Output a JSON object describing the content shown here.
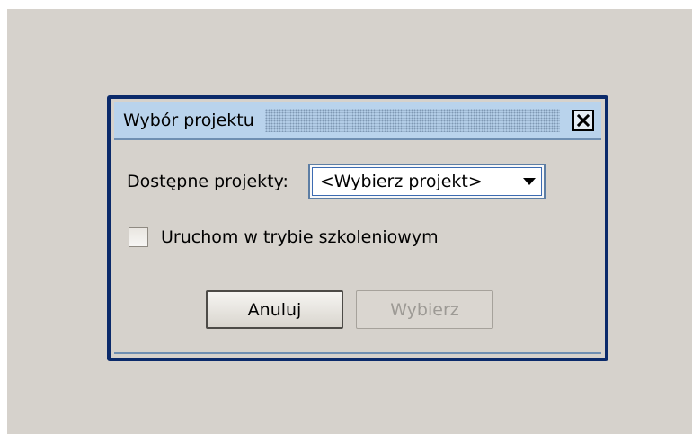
{
  "dialog": {
    "title": "Wybór projektu",
    "close_icon": "close-icon"
  },
  "projects": {
    "label": "Dostępne projekty:",
    "selected": "<Wybierz projekt>",
    "arrow_icon": "chevron-down-icon"
  },
  "training_mode": {
    "label": "Uruchom w trybie szkoleniowym",
    "checked": false
  },
  "buttons": {
    "cancel_label": "Anuluj",
    "select_label": "Wybierz",
    "select_enabled": false
  },
  "colors": {
    "window_border": "#0b2a6a",
    "titlebar": "#b9d3ec",
    "background": "#d6d2cc",
    "disabled_text": "#9d9a95"
  }
}
